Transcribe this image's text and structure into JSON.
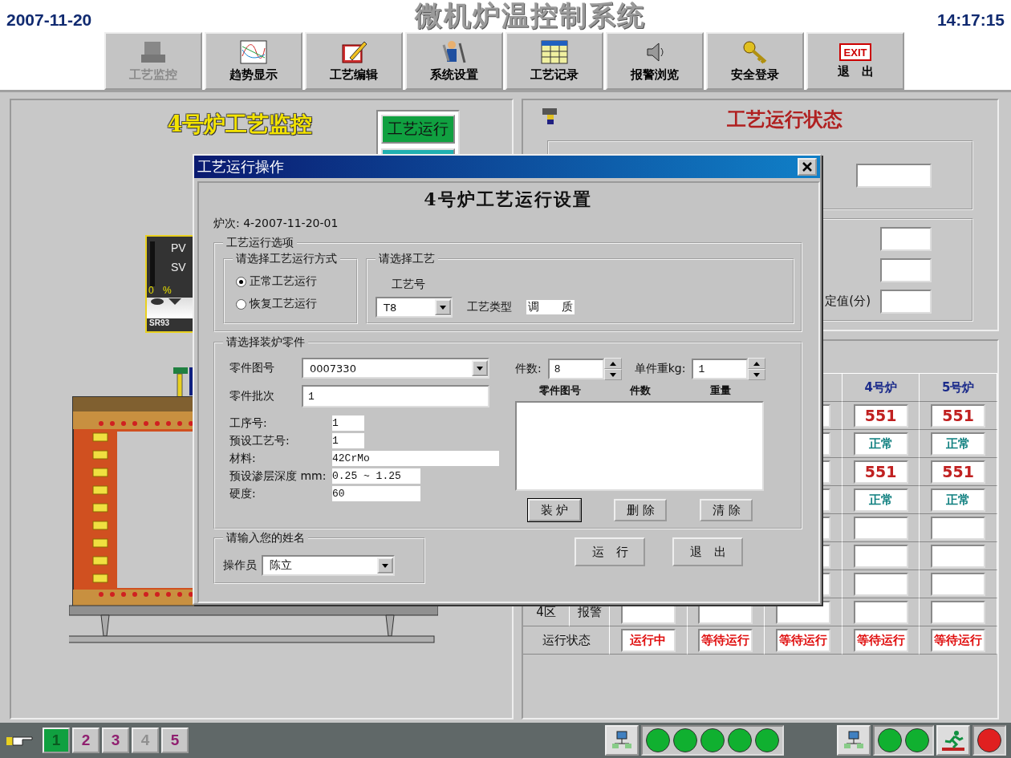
{
  "header": {
    "date": "2007-11-20",
    "title": "微机炉温控制系统",
    "time": "14:17:15"
  },
  "toolbar": [
    {
      "label": "工艺监控",
      "kind": "furnace",
      "disabled": true
    },
    {
      "label": "趋势显示",
      "kind": "trend",
      "disabled": false
    },
    {
      "label": "工艺编辑",
      "kind": "edit",
      "disabled": false
    },
    {
      "label": "系统设置",
      "kind": "tools",
      "disabled": false
    },
    {
      "label": "工艺记录",
      "kind": "table",
      "disabled": false
    },
    {
      "label": "报警浏览",
      "kind": "speaker",
      "disabled": false
    },
    {
      "label": "安全登录",
      "kind": "key",
      "disabled": false
    },
    {
      "label": "退　出",
      "kind": "exit",
      "badge": "EXIT",
      "disabled": false
    }
  ],
  "monitor": {
    "title": "4号炉工艺监控",
    "side_buttons": [
      {
        "label": "工艺运行",
        "selected": true
      },
      {
        "selected": false
      }
    ],
    "controller": {
      "pv": "PV",
      "sv": "SV",
      "zero": "0",
      "unit": "%",
      "model": "SR93"
    }
  },
  "status": {
    "title": "工艺运行状态",
    "setting_label": "定值(分)"
  },
  "table": {
    "columns": [
      {},
      {},
      {},
      {
        "label": "4号炉"
      },
      {
        "label": "5号炉"
      }
    ],
    "rows": [
      {
        "cells": [
          {
            "kind": "empty"
          },
          {
            "kind": "empty"
          },
          {
            "kind": "empty"
          },
          {
            "kind": "temp",
            "value": "551"
          },
          {
            "kind": "temp",
            "value": "551"
          }
        ]
      },
      {
        "cells": [
          {
            "kind": "empty"
          },
          {
            "kind": "empty"
          },
          {
            "kind": "empty"
          },
          {
            "kind": "ok",
            "value": "正常"
          },
          {
            "kind": "ok",
            "value": "正常"
          }
        ]
      },
      {
        "cells": [
          {
            "kind": "empty"
          },
          {
            "kind": "empty"
          },
          {
            "kind": "empty"
          },
          {
            "kind": "temp",
            "value": "551"
          },
          {
            "kind": "temp",
            "value": "551"
          }
        ]
      },
      {
        "cells": [
          {
            "kind": "empty"
          },
          {
            "kind": "empty"
          },
          {
            "kind": "empty"
          },
          {
            "kind": "ok",
            "value": "正常"
          },
          {
            "kind": "ok",
            "value": "正常"
          }
        ]
      },
      {
        "cells": [
          {
            "kind": "empty"
          },
          {
            "kind": "empty"
          },
          {
            "kind": "empty"
          },
          {
            "kind": "empty"
          },
          {
            "kind": "empty"
          }
        ]
      },
      {
        "cells": [
          {
            "kind": "empty"
          },
          {
            "kind": "empty"
          },
          {
            "kind": "empty"
          },
          {
            "kind": "empty"
          },
          {
            "kind": "empty"
          }
        ]
      },
      {
        "cells": [
          {
            "kind": "empty"
          },
          {
            "kind": "empty"
          },
          {
            "kind": "empty"
          },
          {
            "kind": "empty"
          },
          {
            "kind": "empty"
          }
        ]
      },
      {
        "group": "4区",
        "label": "报警",
        "cells": [
          {
            "kind": "empty"
          },
          {
            "kind": "empty"
          },
          {
            "kind": "empty"
          },
          {
            "kind": "empty"
          },
          {
            "kind": "empty"
          }
        ]
      },
      {
        "label": "运行状态",
        "cells": [
          {
            "kind": "state",
            "value": "运行中"
          },
          {
            "kind": "state",
            "value": "等待运行"
          },
          {
            "kind": "state",
            "value": "等待运行"
          },
          {
            "kind": "state",
            "value": "等待运行"
          },
          {
            "kind": "state",
            "value": "等待运行"
          }
        ]
      }
    ]
  },
  "bottom": {
    "pages": [
      {
        "label": "1",
        "selected": true,
        "disabled": false
      },
      {
        "label": "2",
        "selected": false,
        "disabled": false
      },
      {
        "label": "3",
        "selected": false,
        "disabled": false
      },
      {
        "label": "4",
        "selected": false,
        "disabled": true
      },
      {
        "label": "5",
        "selected": false,
        "disabled": false
      }
    ],
    "lights": [
      {
        "color": "#10b030"
      },
      {
        "color": "#10b030"
      },
      {
        "color": "#10b030"
      },
      {
        "color": "#10b030"
      },
      {
        "color": "#10b030"
      }
    ],
    "lights2": [
      {
        "color": "#10b030"
      },
      {
        "color": "#10b030"
      }
    ],
    "alarm": {
      "color": "#e02020"
    }
  },
  "dialog": {
    "title": "工艺运行操作",
    "heading": "4号炉工艺运行设置",
    "batch": "炉次: 4-2007-11-20-01",
    "options_group": "工艺运行选项",
    "mode_group": "请选择工艺运行方式",
    "modes": [
      {
        "label": "正常工艺运行",
        "selected": true
      },
      {
        "label": "恢复工艺运行",
        "selected": false
      }
    ],
    "process_group": "请选择工艺",
    "process_no_label": "工艺号",
    "process_no": "T8",
    "type_label": "工艺类型",
    "type": "调　　质",
    "parts_group": "请选择装炉零件",
    "part_no_label": "零件图号",
    "part_no": "0007330",
    "lot_label": "零件批次",
    "lot": "1",
    "details": [
      {
        "label": "工序号:",
        "value": "1"
      },
      {
        "label": "预设工艺号:",
        "value": "1"
      },
      {
        "label": "材料:",
        "value": "42CrMo"
      },
      {
        "label": "预设渗层深度 mm:",
        "value": "0.25 ~ 1.25"
      },
      {
        "label": "硬度:",
        "value": "60"
      }
    ],
    "count_label": "件数:",
    "count": "8",
    "weight_label": "单件重kg:",
    "weight": "1",
    "list_columns": [
      "零件图号",
      "件数",
      "重量"
    ],
    "list_buttons": [
      {
        "label": "装 炉",
        "focused": true
      },
      {
        "label": "删 除",
        "focused": false
      },
      {
        "label": "清 除",
        "focused": false
      }
    ],
    "operator_group": "请输入您的姓名",
    "operator_label": "操作员",
    "operator": "陈立",
    "buttons": [
      "运　行",
      "退　出"
    ]
  }
}
